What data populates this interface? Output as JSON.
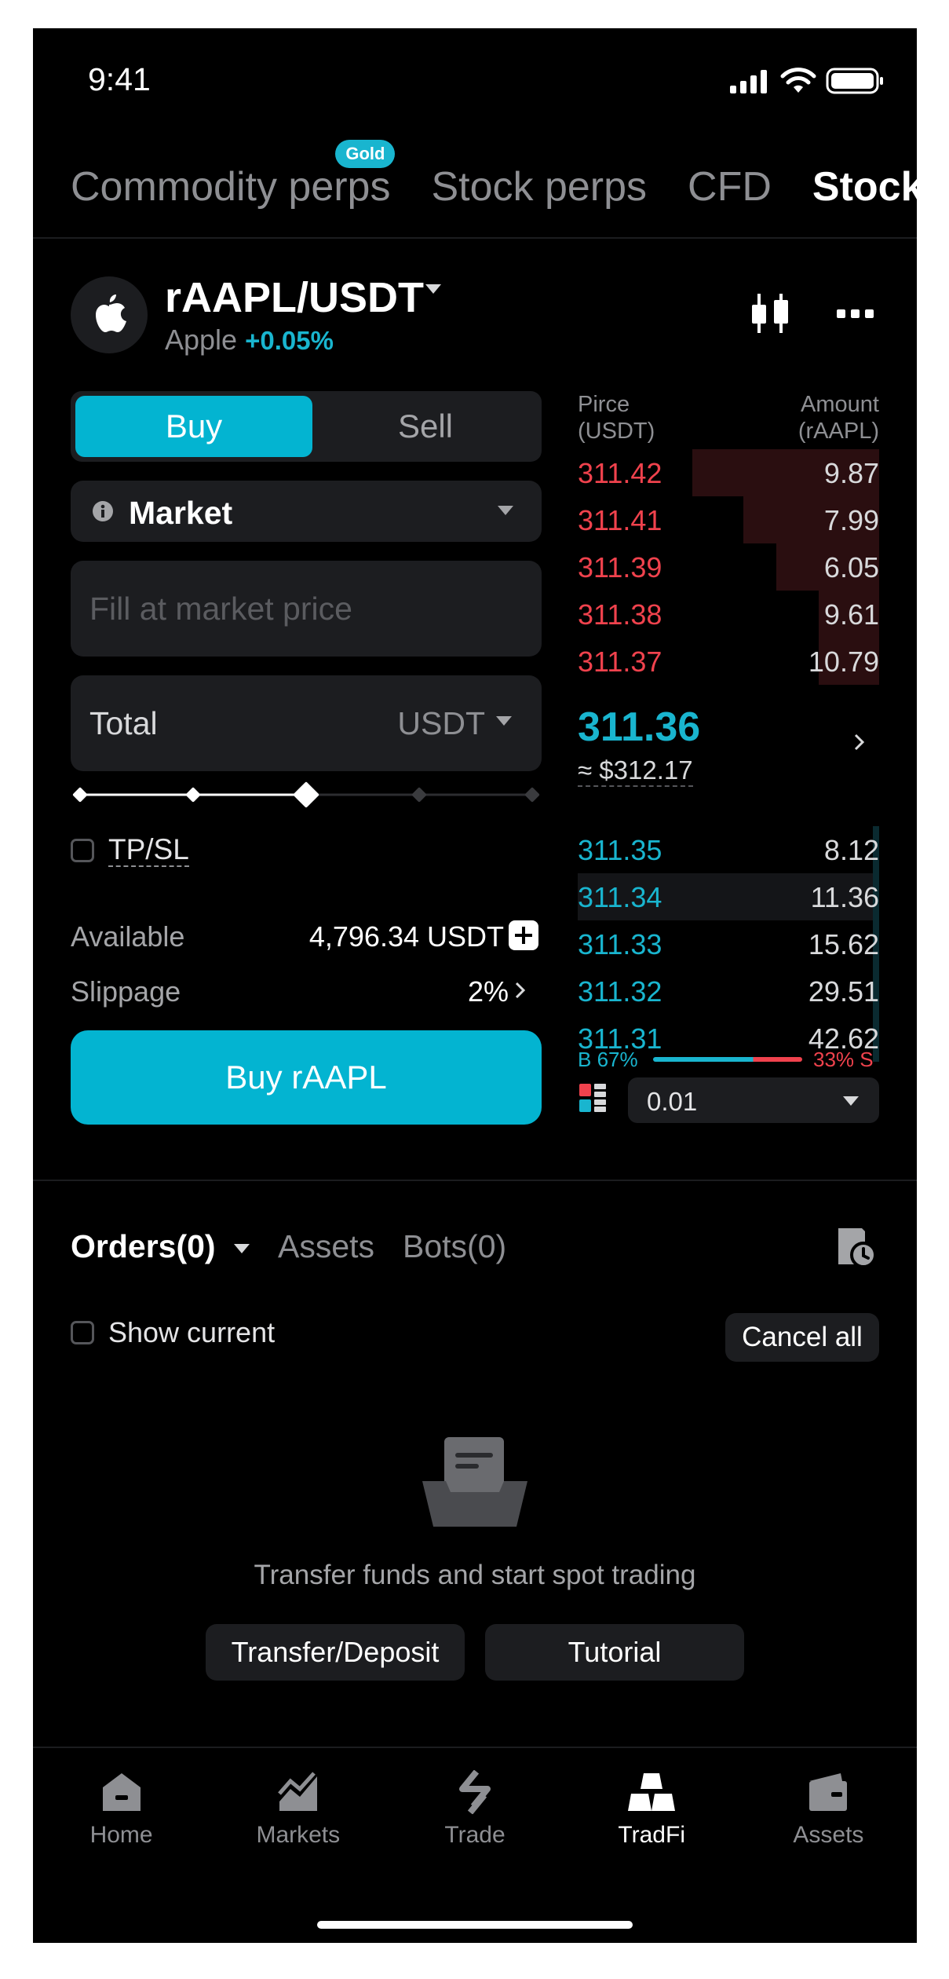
{
  "status": {
    "time": "9:41"
  },
  "tabs": [
    {
      "label": "Commodity perps",
      "badge": "Gold",
      "active": false
    },
    {
      "label": "Stock perps",
      "active": false
    },
    {
      "label": "CFD",
      "active": false
    },
    {
      "label": "Stock t",
      "active": true
    }
  ],
  "pair": {
    "symbol": "rAAPL/USDT",
    "name": "Apple",
    "change": "+0.05%"
  },
  "order_form": {
    "buy_label": "Buy",
    "sell_label": "Sell",
    "order_type": "Market",
    "price_placeholder": "Fill at market price",
    "total_label": "Total",
    "total_unit": "USDT",
    "slider_percent": 50,
    "tpsl_label": "TP/SL",
    "available_label": "Available",
    "available_value": "4,796.34 USDT",
    "slippage_label": "Slippage",
    "slippage_value": "2%",
    "submit_label": "Buy rAAPL"
  },
  "order_book": {
    "price_header": "Pirce\n(USDT)",
    "amount_header": "Amount\n(rAAPL)",
    "asks": [
      {
        "price": "311.42",
        "amount": "9.87",
        "depth": 0.62
      },
      {
        "price": "311.41",
        "amount": "7.99",
        "depth": 0.45
      },
      {
        "price": "311.39",
        "amount": "6.05",
        "depth": 0.34
      },
      {
        "price": "311.38",
        "amount": "9.61",
        "depth": 0.2
      },
      {
        "price": "311.37",
        "amount": "10.79",
        "depth": 0.2
      }
    ],
    "last_price": "311.36",
    "last_usd": "≈ $312.17",
    "bids": [
      {
        "price": "311.35",
        "amount": "8.12",
        "depth": 0.02
      },
      {
        "price": "311.34",
        "amount": "11.36",
        "depth": 0.02
      },
      {
        "price": "311.33",
        "amount": "15.62",
        "depth": 0.02
      },
      {
        "price": "311.32",
        "amount": "29.51",
        "depth": 0.02
      },
      {
        "price": "311.31",
        "amount": "42.62",
        "depth": 0.02
      }
    ],
    "buy_ratio_label": "B 67%",
    "sell_ratio_label": "33% S",
    "buy_ratio": 0.67,
    "precision": "0.01"
  },
  "orders": {
    "tabs": [
      "Orders(0)",
      "Assets",
      "Bots(0)"
    ],
    "show_current_label": "Show current",
    "cancel_all_label": "Cancel all",
    "empty_text": "Transfer funds and start spot trading",
    "deposit_label": "Transfer/Deposit",
    "tutorial_label": "Tutorial"
  },
  "nav": [
    {
      "label": "Home",
      "icon": "home-icon",
      "active": false
    },
    {
      "label": "Markets",
      "icon": "markets-icon",
      "active": false
    },
    {
      "label": "Trade",
      "icon": "trade-icon",
      "active": false
    },
    {
      "label": "TradFi",
      "icon": "tradfi-icon",
      "active": true
    },
    {
      "label": "Assets",
      "icon": "wallet-icon",
      "active": false
    }
  ],
  "colors": {
    "accent": "#03b4d1",
    "ask": "#f0424d",
    "bid": "#19b5cf",
    "background": "#000000"
  }
}
